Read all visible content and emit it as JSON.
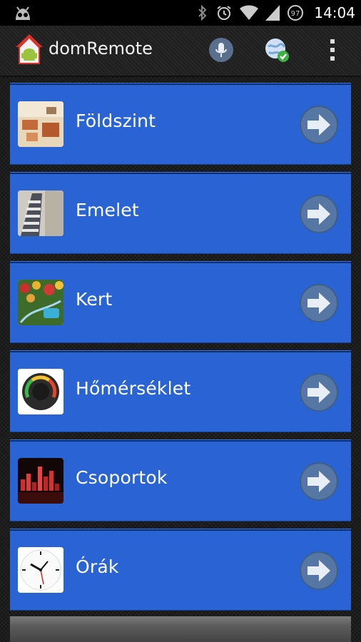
{
  "status_bar": {
    "time": "14:04",
    "battery_level": "97",
    "icons": [
      "android-debug-icon",
      "bluetooth-icon",
      "alarm-icon",
      "wifi-icon",
      "signal-icon",
      "battery-icon"
    ]
  },
  "action_bar": {
    "title": "domRemote",
    "actions": [
      "microphone-icon",
      "sync-globe-icon",
      "overflow-menu-icon"
    ]
  },
  "menu": {
    "items": [
      {
        "label": "Földszint",
        "icon": "living-room-thumbnail"
      },
      {
        "label": "Emelet",
        "icon": "staircase-thumbnail"
      },
      {
        "label": "Kert",
        "icon": "garden-thumbnail"
      },
      {
        "label": "Hőmérséklet",
        "icon": "thermometer-gauge-thumbnail"
      },
      {
        "label": "Csoportok",
        "icon": "groups-chart-thumbnail"
      },
      {
        "label": "Órák",
        "icon": "clock-thumbnail"
      }
    ]
  },
  "colors": {
    "item_background": "#2a63d4",
    "arrow_button": "#3f5f8a",
    "status_bar": "#000000"
  }
}
